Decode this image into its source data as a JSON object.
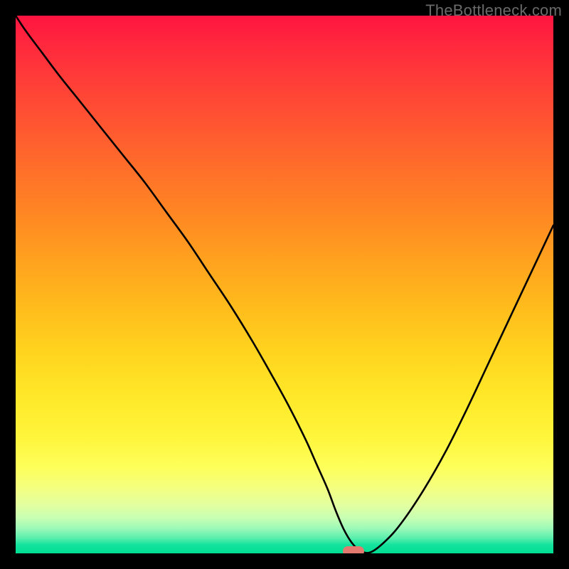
{
  "watermark": "TheBottleneck.com",
  "chart_data": {
    "type": "line",
    "title": "",
    "xlabel": "",
    "ylabel": "",
    "xlim": [
      0,
      100
    ],
    "ylim": [
      0,
      100
    ],
    "grid": false,
    "x": [
      0,
      2,
      5,
      8,
      12,
      16,
      20,
      24,
      28,
      32,
      36,
      40,
      44,
      48,
      51,
      54,
      56,
      58,
      59.5,
      61,
      62.5,
      64,
      66,
      69,
      72,
      76,
      80,
      84,
      88,
      92,
      96,
      100
    ],
    "y": [
      100,
      97,
      93,
      89,
      84,
      79,
      74,
      69,
      63.5,
      58,
      52,
      46,
      39.5,
      32.5,
      27,
      21,
      16.5,
      12,
      8,
      4.5,
      2,
      0.6,
      0.2,
      2.5,
      6,
      12,
      19,
      27,
      35.5,
      44,
      52.5,
      61
    ],
    "marker": {
      "x": 62.8,
      "y": 0.4
    },
    "background_gradient": {
      "orientation": "vertical",
      "stops": [
        {
          "pos": 0.0,
          "color": "#ff1440"
        },
        {
          "pos": 0.5,
          "color": "#ffb01d"
        },
        {
          "pos": 0.8,
          "color": "#fff53a"
        },
        {
          "pos": 0.95,
          "color": "#b0ffad"
        },
        {
          "pos": 1.0,
          "color": "#00dd93"
        }
      ]
    }
  }
}
